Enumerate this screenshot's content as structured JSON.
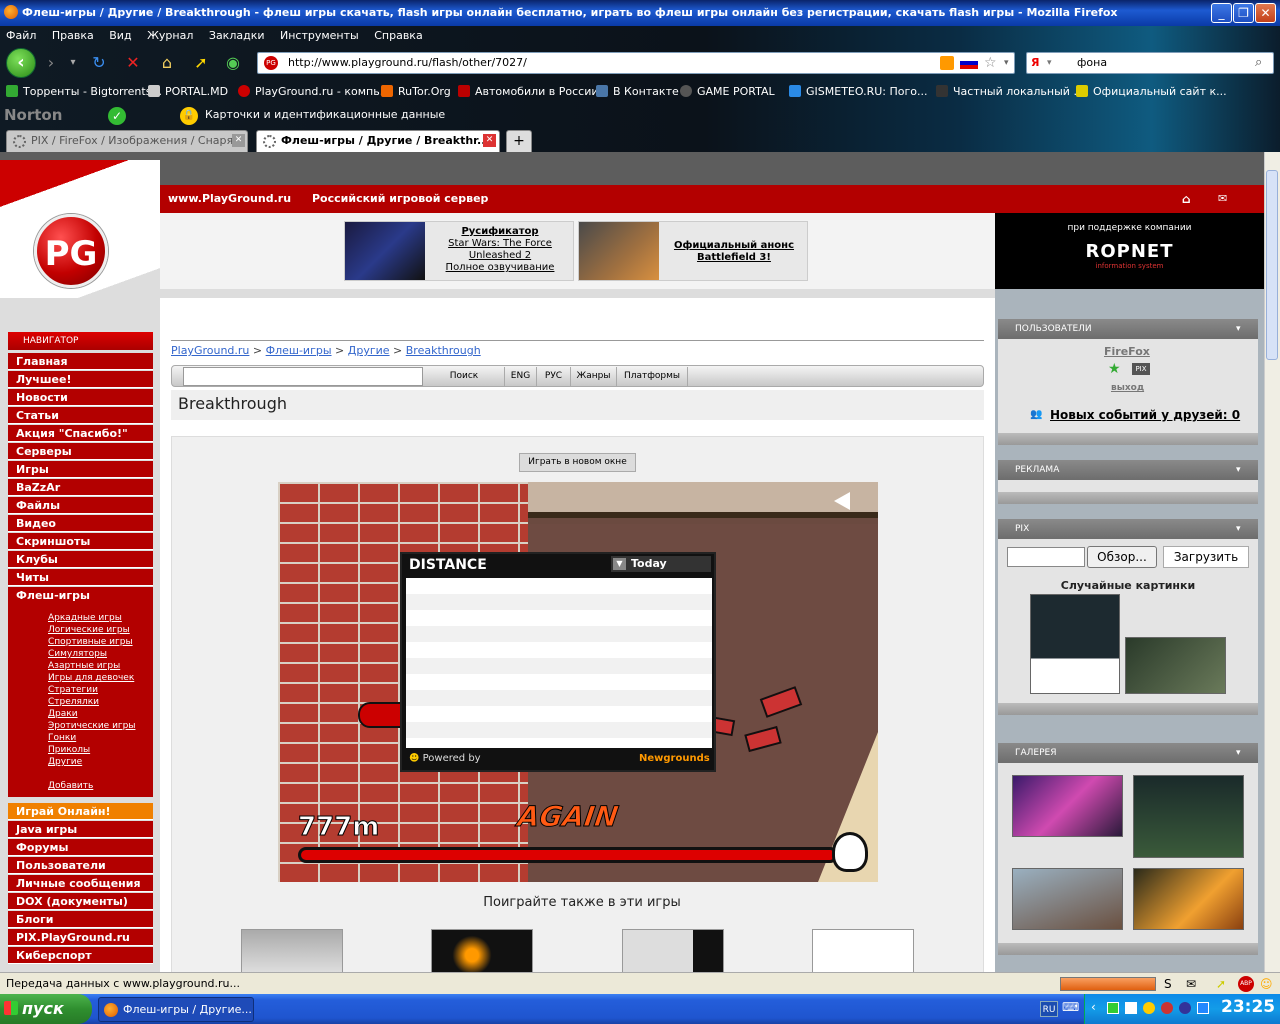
{
  "window": {
    "title": "Флеш-игры / Другие / Breakthrough - флеш игры скачать, flash игры онлайн бесплатно, играть во флеш игры онлайн без регистрации, скачать flash игры - Mozilla Firefox"
  },
  "menu": [
    "Файл",
    "Правка",
    "Вид",
    "Журнал",
    "Закладки",
    "Инструменты",
    "Справка"
  ],
  "address": {
    "url": "http://www.playground.ru/flash/other/7027/",
    "search_value": "фона"
  },
  "bookmarks": [
    "Торренты - Bigtorrents...",
    "PORTAL.MD",
    "PlayGround.ru - компь...",
    "RuTor.Org",
    "Автомобили в России",
    "В Контакте",
    "GAME PORTAL",
    "GISMETEO.RU: Пого...",
    "Частный локальный ...",
    "Официальный сайт к..."
  ],
  "norton": {
    "brand": "Norton",
    "label": "Карточки и идентификационные данные"
  },
  "tabs": [
    {
      "label": "PIX / FireFox / Изображения / Снаря...",
      "active": false
    },
    {
      "label": "Флеш-игры / Другие / Breakthr...",
      "active": true
    }
  ],
  "site": {
    "domain": "www.PlayGround.ru",
    "tagline": "Российский игровой сервер",
    "logo": "PG",
    "banner1": {
      "line1": "Русификатор",
      "line2": "Star Wars: The Force",
      "line3": "Unleashed 2",
      "line4": "Полное озвучивание"
    },
    "banner2": {
      "line1": "Официальный анонс",
      "line2": "Battlefield 3!"
    },
    "sponsor_caption": "при поддержке компании",
    "sponsor_name": "ROPNET",
    "sponsor_sub": "information system"
  },
  "nav": {
    "header": "НАВИГАТОР",
    "items": [
      "Главная",
      "Лучшее!",
      "Новости",
      "Статьи",
      "Акция \"Спасибо!\"",
      "Серверы",
      "Игры",
      "BaZzAr",
      "Файлы",
      "Видео",
      "Скриншоты",
      "Клубы",
      "Читы",
      "Флеш-игры"
    ],
    "subitems": [
      "Аркадные игры",
      "Логические игры",
      "Спортивные игры",
      "Симуляторы",
      "Азартные игры",
      "Игры для девочек",
      "Стратегии",
      "Стрелялки",
      "Драки",
      "Эротические игры",
      "Гонки",
      "Приколы",
      "Другие"
    ],
    "add": "Добавить",
    "highlight": "Играй Онлайн!",
    "items2": [
      "Java игры",
      "Форумы",
      "Пользователи",
      "Личные сообщения",
      "DOX (документы)",
      "Блоги",
      "PIX.PlayGround.ru",
      "Киберспорт"
    ]
  },
  "breadcrumb": [
    "PlayGround.ru",
    ">",
    "Флеш-игры",
    ">",
    "Другие",
    ">",
    "Breakthrough"
  ],
  "searchbar": {
    "search": "Поиск",
    "eng": "ENG",
    "rus": "РУС",
    "genres": "Жанры",
    "platforms": "Платформы"
  },
  "game": {
    "title": "Breakthrough",
    "play_new_window": "Играть в новом окне",
    "distance_label": "DISTANCE",
    "period": "Today",
    "powered_by": "Powered by",
    "powered_brand": "Newgrounds",
    "again": "AGAIN",
    "meters": "777m",
    "also_play": "Поиграйте также в эти игры"
  },
  "right": {
    "users_header": "ПОЛЬЗОВАТЕЛИ",
    "username": "FireFox",
    "pix_badge": "PIX",
    "logout": "выход",
    "friends_events": "Новых событий у друзей: 0",
    "ads_header": "РЕКЛАМА",
    "pix_header": "PIX",
    "browse_btn": "Обзор...",
    "upload_btn": "Загрузить",
    "random_pics": "Случайные картинки",
    "gallery_header": "ГАЛЕРЕЯ"
  },
  "status": "Передача данных с www.playground.ru...",
  "taskbar": {
    "start": "пуск",
    "task": "Флеш-игры / Другие...",
    "lang": "RU",
    "clock": "23:25"
  }
}
